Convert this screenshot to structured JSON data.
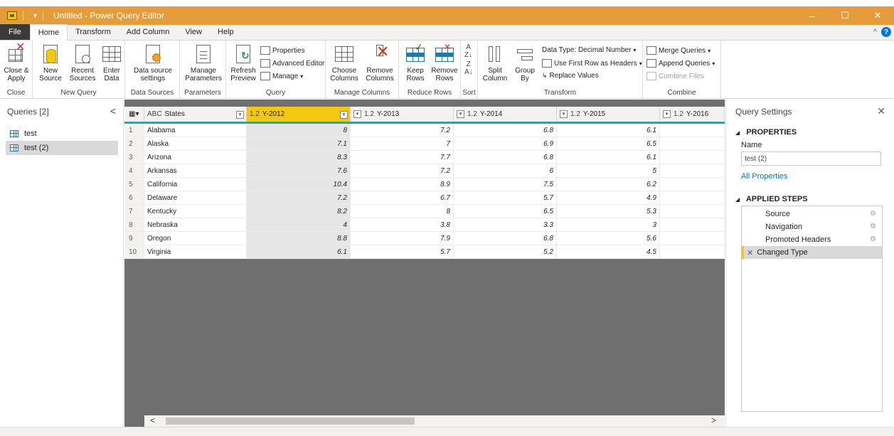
{
  "window": {
    "title": "Untitled - Power Query Editor",
    "controls": {
      "minimize": "–",
      "maximize": "☐",
      "close": "✕"
    }
  },
  "menu": {
    "tabs": [
      "File",
      "Home",
      "Transform",
      "Add Column",
      "View",
      "Help"
    ],
    "active": "Home",
    "collapse_icon": "^",
    "help": "?"
  },
  "ribbon": {
    "close": {
      "button": "Close & Apply",
      "group": "Close"
    },
    "new_query": {
      "new_source": "New Source",
      "recent_sources": "Recent Sources",
      "enter_data": "Enter Data",
      "group": "New Query"
    },
    "data_sources": {
      "settings": "Data source settings",
      "group": "Data Sources"
    },
    "parameters": {
      "manage": "Manage Parameters",
      "group": "Parameters"
    },
    "query": {
      "refresh": "Refresh Preview",
      "properties": "Properties",
      "advanced_editor": "Advanced Editor",
      "manage": "Manage",
      "group": "Query"
    },
    "manage_columns": {
      "choose": "Choose Columns",
      "remove": "Remove Columns",
      "group": "Manage Columns"
    },
    "reduce_rows": {
      "keep": "Keep Rows",
      "remove": "Remove Rows",
      "group": "Reduce Rows"
    },
    "sort": {
      "group": "Sort"
    },
    "transform": {
      "split": "Split Column",
      "group_by": "Group By",
      "data_type": "Data Type: Decimal Number",
      "first_row": "Use First Row as Headers",
      "replace": "Replace Values",
      "group": "Transform"
    },
    "combine": {
      "merge": "Merge Queries",
      "append": "Append Queries",
      "combine_files": "Combine Files",
      "group": "Combine"
    }
  },
  "queries": {
    "title": "Queries [2]",
    "collapse_icon": "<",
    "items": [
      "test",
      "test (2)"
    ],
    "selected": "test (2)"
  },
  "table": {
    "columns": [
      {
        "type": "ABC",
        "name": "States"
      },
      {
        "type": "1.2",
        "name": "Y-2012"
      },
      {
        "type": "1.2",
        "name": "Y-2013"
      },
      {
        "type": "1.2",
        "name": "Y-2014"
      },
      {
        "type": "1.2",
        "name": "Y-2015"
      },
      {
        "type": "1.2",
        "name": "Y-2016"
      }
    ],
    "selected_column": "Y-2012",
    "rows": [
      {
        "idx": "1",
        "state": "Alabama",
        "y2012": "8",
        "y2013": "7.2",
        "y2014": "6.8",
        "y2015": "6.1"
      },
      {
        "idx": "2",
        "state": "Alaska",
        "y2012": "7.1",
        "y2013": "7",
        "y2014": "6.9",
        "y2015": "6.5"
      },
      {
        "idx": "3",
        "state": "Arizona",
        "y2012": "8.3",
        "y2013": "7.7",
        "y2014": "6.8",
        "y2015": "6.1"
      },
      {
        "idx": "4",
        "state": "Arkansas",
        "y2012": "7.6",
        "y2013": "7.2",
        "y2014": "6",
        "y2015": "5"
      },
      {
        "idx": "5",
        "state": "California",
        "y2012": "10.4",
        "y2013": "8.9",
        "y2014": "7.5",
        "y2015": "6.2"
      },
      {
        "idx": "6",
        "state": "Delaware",
        "y2012": "7.2",
        "y2013": "6.7",
        "y2014": "5.7",
        "y2015": "4.9"
      },
      {
        "idx": "7",
        "state": "Kentucky",
        "y2012": "8.2",
        "y2013": "8",
        "y2014": "6.5",
        "y2015": "5.3"
      },
      {
        "idx": "8",
        "state": "Nebraska",
        "y2012": "4",
        "y2013": "3.8",
        "y2014": "3.3",
        "y2015": "3"
      },
      {
        "idx": "9",
        "state": "Oregon",
        "y2012": "8.8",
        "y2013": "7.9",
        "y2014": "6.8",
        "y2015": "5.6"
      },
      {
        "idx": "10",
        "state": "Virginia",
        "y2012": "6.1",
        "y2013": "5.7",
        "y2014": "5.2",
        "y2015": "4.5"
      }
    ]
  },
  "settings": {
    "title": "Query Settings",
    "close_icon": "✕",
    "properties_header": "PROPERTIES",
    "name_label": "Name",
    "name_value": "test (2)",
    "all_properties": "All Properties",
    "steps_header": "APPLIED STEPS",
    "steps": [
      "Source",
      "Navigation",
      "Promoted Headers",
      "Changed Type"
    ],
    "selected_step": "Changed Type"
  },
  "colors": {
    "titlebar": "#e59c3a",
    "selected_column": "#f2c811",
    "header_underline": "#01b8aa",
    "link": "#0078d4"
  }
}
